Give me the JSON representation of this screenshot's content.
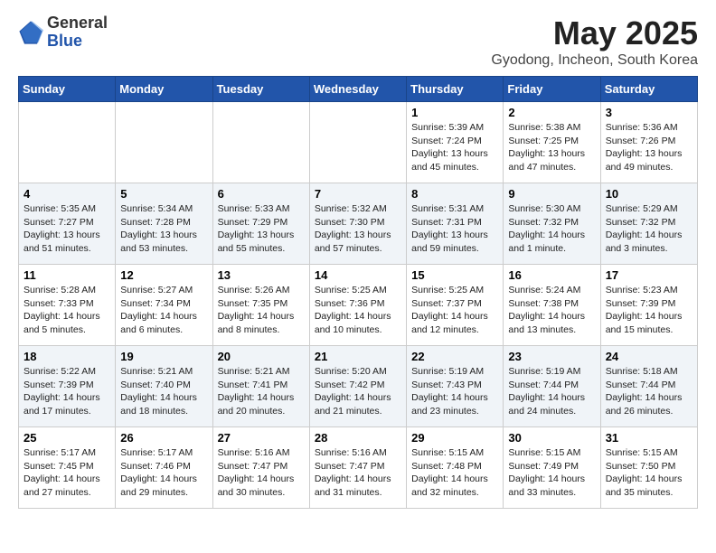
{
  "logo": {
    "general": "General",
    "blue": "Blue"
  },
  "header": {
    "title": "May 2025",
    "subtitle": "Gyodong, Incheon, South Korea"
  },
  "weekdays": [
    "Sunday",
    "Monday",
    "Tuesday",
    "Wednesday",
    "Thursday",
    "Friday",
    "Saturday"
  ],
  "weeks": [
    [
      {
        "day": "",
        "info": ""
      },
      {
        "day": "",
        "info": ""
      },
      {
        "day": "",
        "info": ""
      },
      {
        "day": "",
        "info": ""
      },
      {
        "day": "1",
        "info": "Sunrise: 5:39 AM\nSunset: 7:24 PM\nDaylight: 13 hours\nand 45 minutes."
      },
      {
        "day": "2",
        "info": "Sunrise: 5:38 AM\nSunset: 7:25 PM\nDaylight: 13 hours\nand 47 minutes."
      },
      {
        "day": "3",
        "info": "Sunrise: 5:36 AM\nSunset: 7:26 PM\nDaylight: 13 hours\nand 49 minutes."
      }
    ],
    [
      {
        "day": "4",
        "info": "Sunrise: 5:35 AM\nSunset: 7:27 PM\nDaylight: 13 hours\nand 51 minutes."
      },
      {
        "day": "5",
        "info": "Sunrise: 5:34 AM\nSunset: 7:28 PM\nDaylight: 13 hours\nand 53 minutes."
      },
      {
        "day": "6",
        "info": "Sunrise: 5:33 AM\nSunset: 7:29 PM\nDaylight: 13 hours\nand 55 minutes."
      },
      {
        "day": "7",
        "info": "Sunrise: 5:32 AM\nSunset: 7:30 PM\nDaylight: 13 hours\nand 57 minutes."
      },
      {
        "day": "8",
        "info": "Sunrise: 5:31 AM\nSunset: 7:31 PM\nDaylight: 13 hours\nand 59 minutes."
      },
      {
        "day": "9",
        "info": "Sunrise: 5:30 AM\nSunset: 7:32 PM\nDaylight: 14 hours\nand 1 minute."
      },
      {
        "day": "10",
        "info": "Sunrise: 5:29 AM\nSunset: 7:32 PM\nDaylight: 14 hours\nand 3 minutes."
      }
    ],
    [
      {
        "day": "11",
        "info": "Sunrise: 5:28 AM\nSunset: 7:33 PM\nDaylight: 14 hours\nand 5 minutes."
      },
      {
        "day": "12",
        "info": "Sunrise: 5:27 AM\nSunset: 7:34 PM\nDaylight: 14 hours\nand 6 minutes."
      },
      {
        "day": "13",
        "info": "Sunrise: 5:26 AM\nSunset: 7:35 PM\nDaylight: 14 hours\nand 8 minutes."
      },
      {
        "day": "14",
        "info": "Sunrise: 5:25 AM\nSunset: 7:36 PM\nDaylight: 14 hours\nand 10 minutes."
      },
      {
        "day": "15",
        "info": "Sunrise: 5:25 AM\nSunset: 7:37 PM\nDaylight: 14 hours\nand 12 minutes."
      },
      {
        "day": "16",
        "info": "Sunrise: 5:24 AM\nSunset: 7:38 PM\nDaylight: 14 hours\nand 13 minutes."
      },
      {
        "day": "17",
        "info": "Sunrise: 5:23 AM\nSunset: 7:39 PM\nDaylight: 14 hours\nand 15 minutes."
      }
    ],
    [
      {
        "day": "18",
        "info": "Sunrise: 5:22 AM\nSunset: 7:39 PM\nDaylight: 14 hours\nand 17 minutes."
      },
      {
        "day": "19",
        "info": "Sunrise: 5:21 AM\nSunset: 7:40 PM\nDaylight: 14 hours\nand 18 minutes."
      },
      {
        "day": "20",
        "info": "Sunrise: 5:21 AM\nSunset: 7:41 PM\nDaylight: 14 hours\nand 20 minutes."
      },
      {
        "day": "21",
        "info": "Sunrise: 5:20 AM\nSunset: 7:42 PM\nDaylight: 14 hours\nand 21 minutes."
      },
      {
        "day": "22",
        "info": "Sunrise: 5:19 AM\nSunset: 7:43 PM\nDaylight: 14 hours\nand 23 minutes."
      },
      {
        "day": "23",
        "info": "Sunrise: 5:19 AM\nSunset: 7:44 PM\nDaylight: 14 hours\nand 24 minutes."
      },
      {
        "day": "24",
        "info": "Sunrise: 5:18 AM\nSunset: 7:44 PM\nDaylight: 14 hours\nand 26 minutes."
      }
    ],
    [
      {
        "day": "25",
        "info": "Sunrise: 5:17 AM\nSunset: 7:45 PM\nDaylight: 14 hours\nand 27 minutes."
      },
      {
        "day": "26",
        "info": "Sunrise: 5:17 AM\nSunset: 7:46 PM\nDaylight: 14 hours\nand 29 minutes."
      },
      {
        "day": "27",
        "info": "Sunrise: 5:16 AM\nSunset: 7:47 PM\nDaylight: 14 hours\nand 30 minutes."
      },
      {
        "day": "28",
        "info": "Sunrise: 5:16 AM\nSunset: 7:47 PM\nDaylight: 14 hours\nand 31 minutes."
      },
      {
        "day": "29",
        "info": "Sunrise: 5:15 AM\nSunset: 7:48 PM\nDaylight: 14 hours\nand 32 minutes."
      },
      {
        "day": "30",
        "info": "Sunrise: 5:15 AM\nSunset: 7:49 PM\nDaylight: 14 hours\nand 33 minutes."
      },
      {
        "day": "31",
        "info": "Sunrise: 5:15 AM\nSunset: 7:50 PM\nDaylight: 14 hours\nand 35 minutes."
      }
    ]
  ]
}
